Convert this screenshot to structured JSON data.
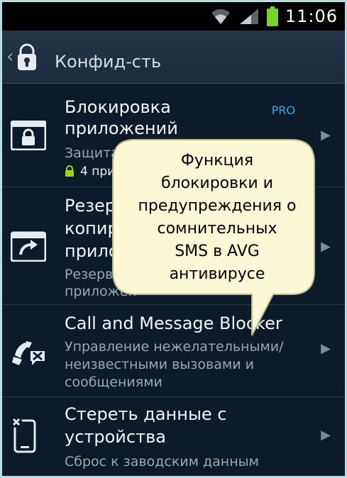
{
  "status_bar": {
    "time": "11:06"
  },
  "header": {
    "back_glyph": "‹",
    "title": "Конфид-сть"
  },
  "items": [
    {
      "title_line1": "Блокировка",
      "title_line2": "приложений",
      "pro": "PRO",
      "subtitle": "Защита",
      "badge": "4 при"
    },
    {
      "title_line1": "Резер",
      "title_line2": "копир",
      "title_line3": "прило",
      "sub_line1": "Резерв",
      "sub_line2": "приложен"
    },
    {
      "title": "Call and Message Blocker",
      "sub_line1": "Управление нежелательными/",
      "sub_line2": "неизвестными вызовами и",
      "sub_line3": "сообщениями"
    },
    {
      "title_line1": "Стереть данные с",
      "title_line2": "устройства",
      "subtitle": "Сброс к заводским данным"
    }
  ],
  "callout": {
    "line1": "Функция",
    "line2": "блокировки и",
    "line3": "предупреждения о",
    "line4": "сомнительных",
    "line5": "SMS в AVG",
    "line6": "антивирусе"
  },
  "colors": {
    "pro": "#3ba2e0",
    "callout_fill": "#fbf8d5",
    "badge_lock": "#9fd21b"
  }
}
